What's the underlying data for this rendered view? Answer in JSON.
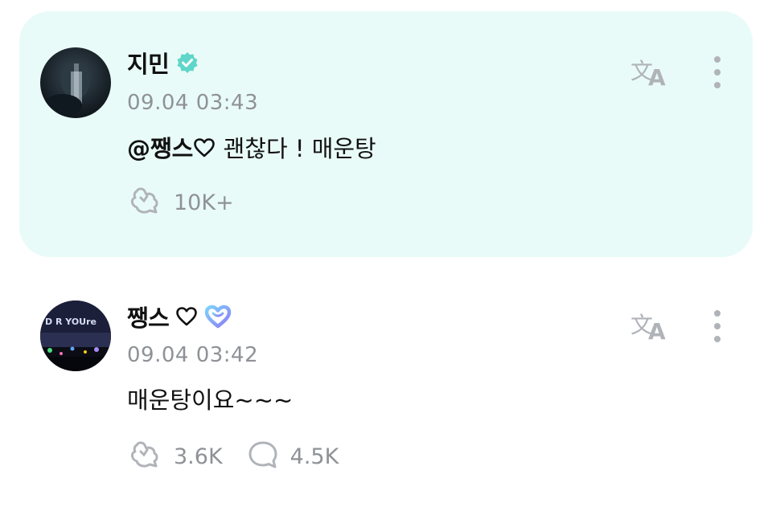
{
  "comments": [
    {
      "author": "지민",
      "badge": "verified-badge-icon",
      "timestamp": "09.04 03:43",
      "mention": "@쨍스",
      "text": "괜찮다 ! 매운탕",
      "like_count": "10K+",
      "reply_count": null,
      "highlighted": true,
      "colors": {
        "background": "#e9fbf8",
        "badge": "#5fd6c9"
      }
    },
    {
      "author": "쨍스",
      "badge": "fan-heart-badge-icon",
      "timestamp": "09.04 03:42",
      "text": "매운탕이요~~~",
      "like_count": "3.6K",
      "reply_count": "4.5K",
      "highlighted": false,
      "colors": {
        "background": "#ffffff",
        "badge": "#8b7cf6"
      }
    }
  ],
  "icons": {
    "translate": "translate-icon",
    "more": "more-vertical-icon",
    "like": "like-icon",
    "reply": "comment-bubble-icon",
    "heart": "heart-outline-icon"
  },
  "colors": {
    "muted_text": "#8e9297",
    "icon_gray": "#b0b4b9",
    "text": "#111111"
  }
}
